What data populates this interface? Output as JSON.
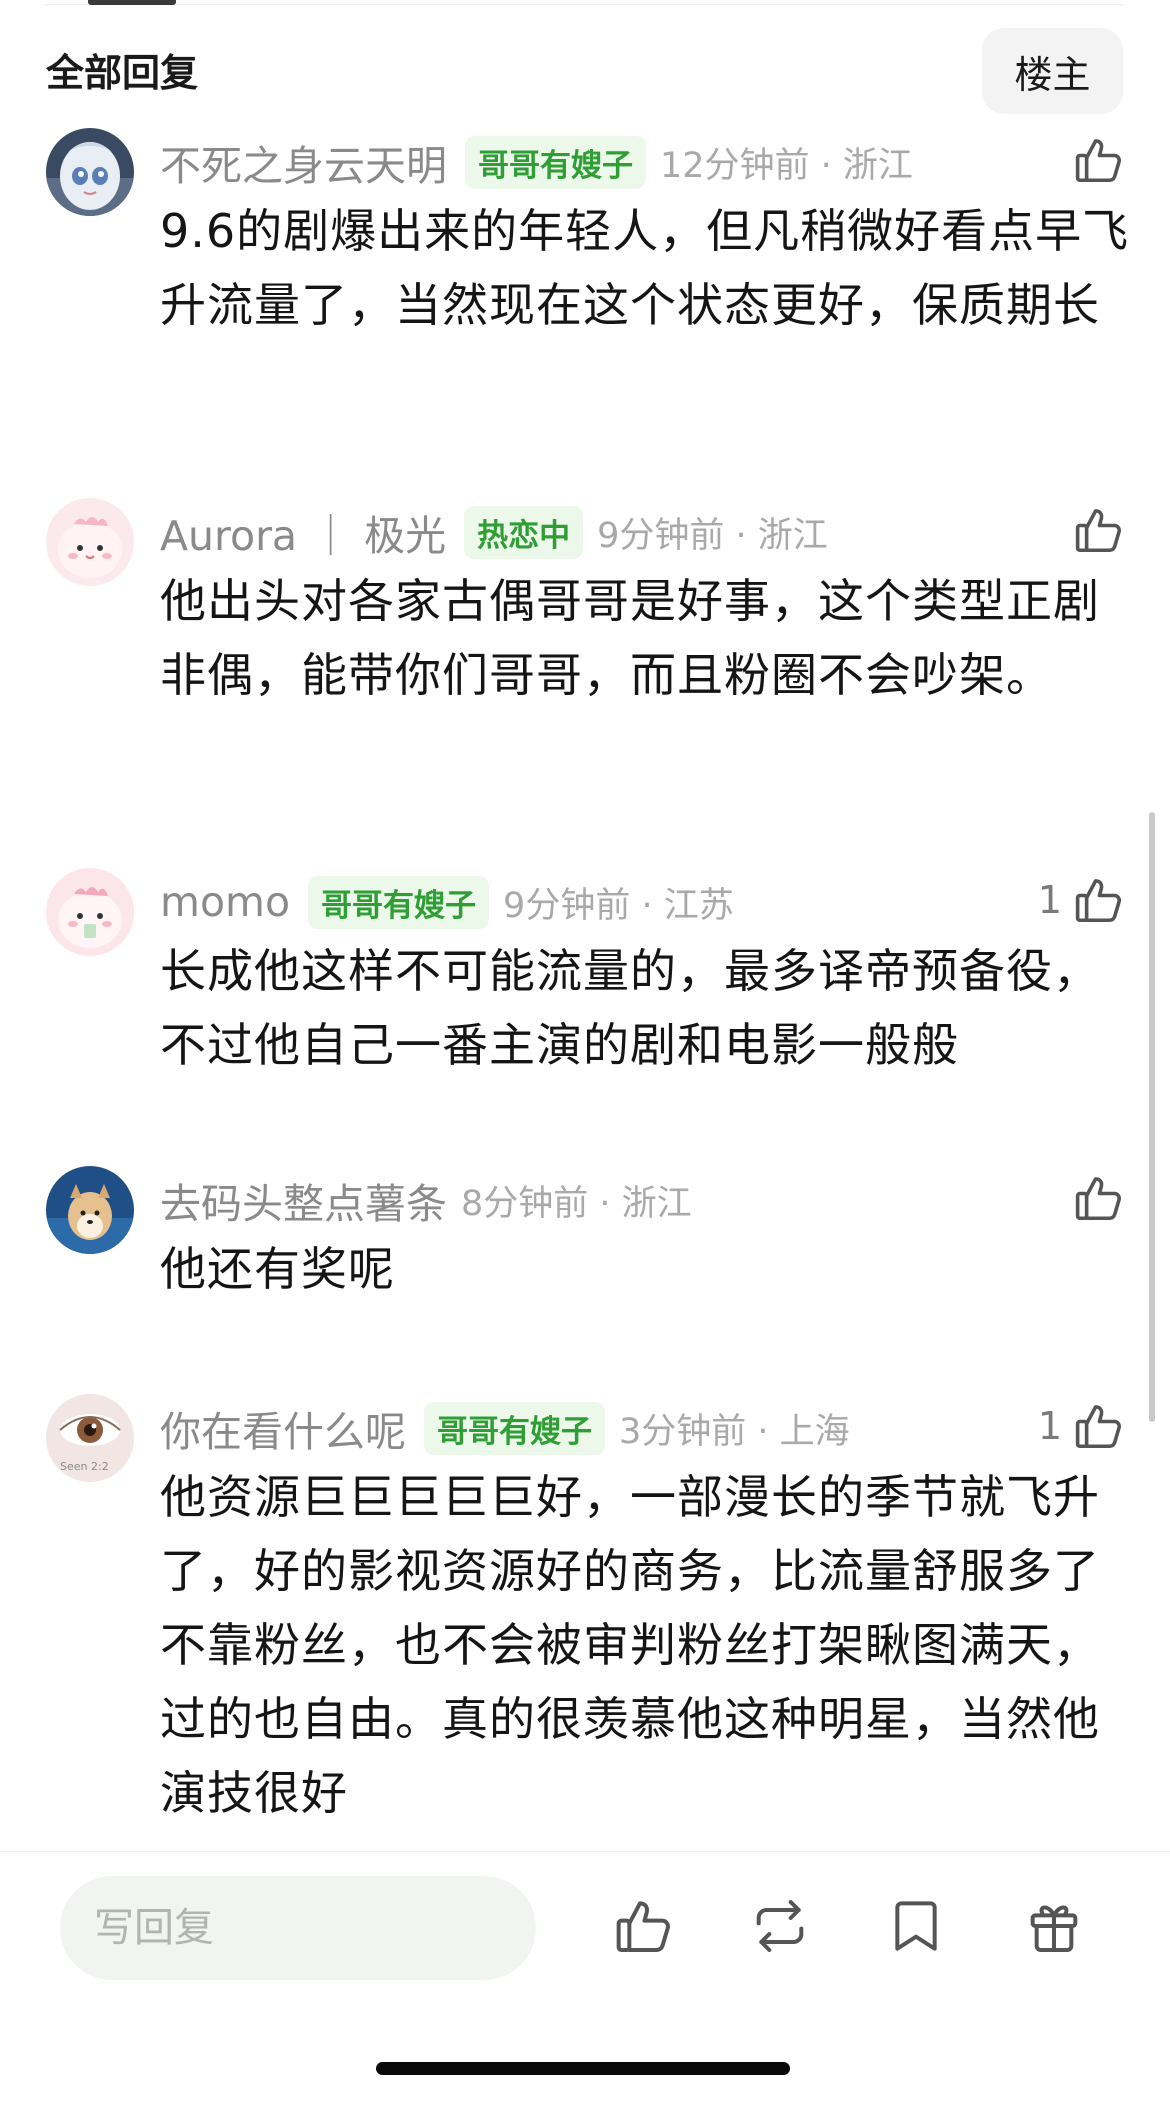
{
  "header": {
    "title": "全部回复",
    "op_filter_label": "楼主"
  },
  "comments": [
    {
      "user": "不死之身云天明",
      "badge": "哥哥有嫂子",
      "time": "12分钟前 · 浙江",
      "likes": "",
      "text": "9.6的剧爆出来的年轻人，但凡稍微好看点早飞升流量了，当然现在这个状态更好，保质期长"
    },
    {
      "user": "Aurora ｜ 极光",
      "badge": "热恋中",
      "time": "9分钟前 · 浙江",
      "likes": "",
      "text": "他出头对各家古偶哥哥是好事，这个类型正剧 非偶，能带你们哥哥，而且粉圈不会吵架。"
    },
    {
      "user": "momo",
      "badge": "哥哥有嫂子",
      "time": "9分钟前 · 江苏",
      "likes": "1",
      "text": "长成他这样不可能流量的，最多译帝预备役，不过他自己一番主演的剧和电影一般般"
    },
    {
      "user": "去码头整点薯条",
      "badge": "",
      "time": "8分钟前 · 浙江",
      "likes": "",
      "text": "他还有奖呢"
    },
    {
      "user": "你在看什么呢",
      "badge": "哥哥有嫂子",
      "time": "3分钟前 · 上海",
      "likes": "1",
      "text": "他资源巨巨巨巨巨好，一部漫长的季节就飞升了，好的影视资源好的商务，比流量舒服多了不靠粉丝，也不会被审判粉丝打架瞅图满天，过的也自由。真的很羡慕他这种明星，当然他演技很好"
    }
  ],
  "avatar_texts": {
    "seen": "Seen 2:2"
  },
  "bottom_bar": {
    "reply_placeholder": "写回复"
  },
  "colors": {
    "badge_bg": "#ebf8ea",
    "badge_text": "#2f9e35",
    "meta_text": "#8a8a8a"
  },
  "icons": [
    "thumb-up-icon",
    "repost-icon",
    "bookmark-icon",
    "gift-icon"
  ]
}
